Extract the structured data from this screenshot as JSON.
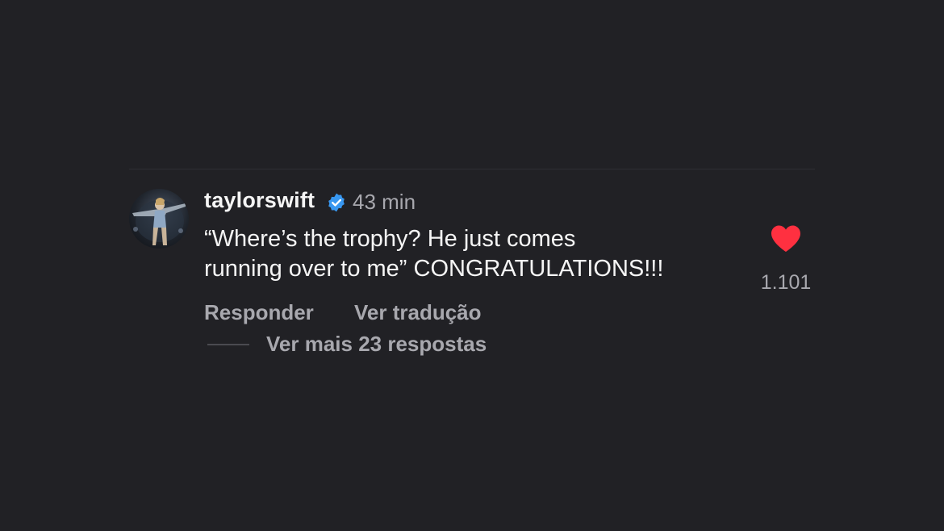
{
  "comment": {
    "username": "taylorswift",
    "verified_icon": "verified-badge-icon",
    "timestamp": "43 min",
    "text_line1": "“Where’s the trophy? He just comes",
    "text_line2": "running over to me” CONGRATULATIONS!!!",
    "liked": true,
    "like_count": "1.101",
    "reply_label": "Responder",
    "translate_label": "Ver tradução",
    "view_replies_label": "Ver mais 23 respostas"
  },
  "colors": {
    "background": "#212125",
    "text_primary": "#f5f5f5",
    "text_secondary": "#a8a8ae",
    "verified_blue": "#3897f0",
    "heart_red": "#ff3040"
  }
}
